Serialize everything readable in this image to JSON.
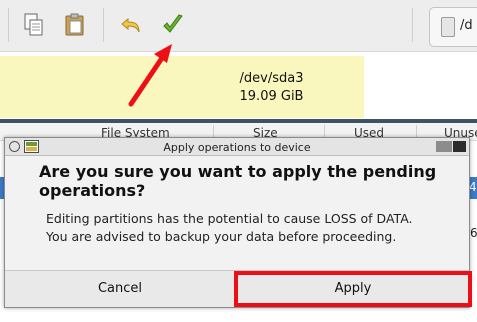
{
  "toolbar": {
    "device_label": "/d",
    "icons": [
      "copy-icon",
      "paste-icon",
      "undo-icon",
      "apply-checkmark-icon",
      "disk-icon"
    ]
  },
  "graph": {
    "partition_name": "/dev/sda3",
    "partition_size": "19.09 GiB"
  },
  "list": {
    "columns": [
      "File System",
      "Size",
      "Used",
      "Unused"
    ],
    "peek_row_1": "4",
    "peek_row_2": "6"
  },
  "dialog": {
    "title": "Apply operations to device",
    "heading": "Are you sure you want to apply the pending operations?",
    "body_line_1": "Editing partitions has the potential to cause LOSS of DATA.",
    "body_line_2": "You are advised to backup your data before proceeding.",
    "cancel_label": "Cancel",
    "apply_label": "Apply"
  },
  "colors": {
    "partition_fill": "#f9f7bd",
    "divider": "#3f5363",
    "annotation_red": "#ee0f16",
    "selection_blue": "#3d7bc7"
  }
}
